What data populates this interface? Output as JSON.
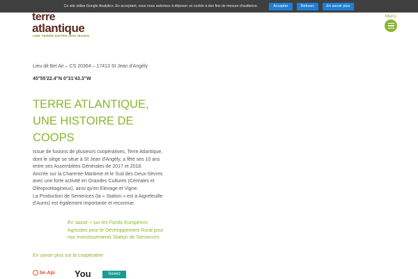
{
  "cookie_bar": {
    "text": "Ce site utilise Google Analytics. En acceptant, vous nous autorisez à déposer un cookie à des fins de mesure d'audience.",
    "accept": "Accepter",
    "refuse": "Refuser",
    "more": "En savoir plus"
  },
  "logo": {
    "line1": "terre",
    "line2": "atlantique",
    "tagline": "UNE TERRE ENTRE NOS MAINS"
  },
  "menu": {
    "label": "Menu"
  },
  "contact": {
    "address": "Lieu dit Bel Air – CS 20364 – 17413 St Jean d'Angély",
    "gps": "45°55'22.4\"N 0°31'43.3\"W"
  },
  "main": {
    "title_lines": [
      "TERRE ATLANTIQUE,",
      "UNE HISTOIRE DE",
      "COOPS"
    ],
    "paragraphs": [
      "Issue de fusions de plusieurs coopératives, Terre Atlantique, dont le siège se situe à St Jean d'Angély, a fêté ses 10 ans entre ses Assemblées Générales de 2017 et 2018.",
      "Ancrée sur la Charente-Maritime et le Sud des Deux-Sèvres avec une forte activité en Grandes Cultures (Céréales et Oléoprotéagineux), ainsi qu'en Elevage et Vigne.",
      "La Production de Semences (la « Station » est à Aigrefeuille d'Aunis) est également importante et reconnue."
    ],
    "eu_link": "En savoir + sur les Fonds Européens Agricoles pour le Développement Rural pour nos investissements Station de Semences",
    "coop_link": "En savoir plus sur la coopérative"
  },
  "footer": {
    "beapi": "be-Api",
    "youtube": "You",
    "follow": "Suivez"
  },
  "colors": {
    "accent_green": "#8ab52f",
    "cookie_button": "#1f7fd8",
    "follow_button": "#1a9a94",
    "logo_brown": "#5c2a20"
  }
}
